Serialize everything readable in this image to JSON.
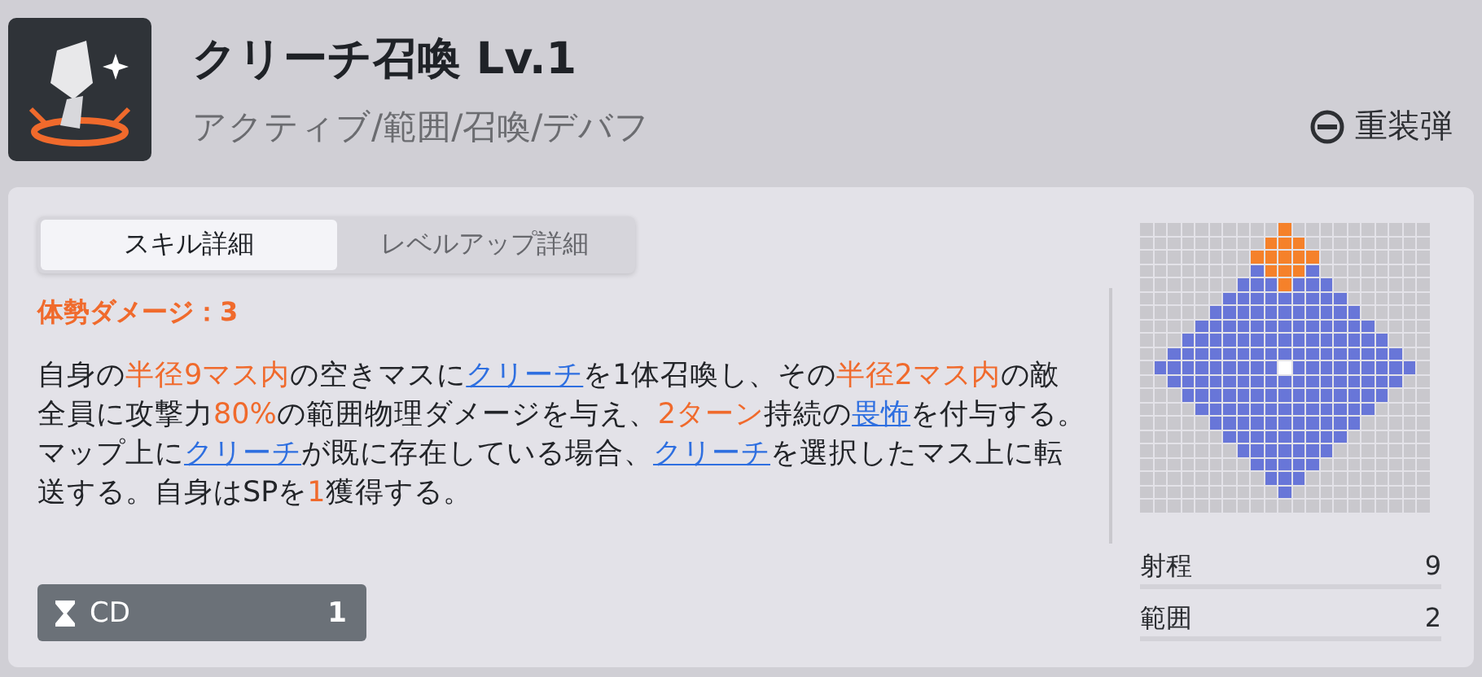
{
  "header": {
    "title": "クリーチ召喚 Lv.1",
    "tags": "アクティブ/範囲/召喚/デバフ",
    "ammo": "重装弾"
  },
  "tabs": [
    {
      "label": "スキル詳細",
      "selected": true
    },
    {
      "label": "レベルアップ詳細",
      "selected": false
    }
  ],
  "posture_damage": "体勢ダメージ：3",
  "description": [
    {
      "kind": "plain",
      "text": "自身の"
    },
    {
      "kind": "highlight",
      "text": "半径9マス内"
    },
    {
      "kind": "plain",
      "text": "の空きマスに"
    },
    {
      "kind": "link",
      "text": "クリーチ"
    },
    {
      "kind": "plain",
      "text": "を1体召喚し、その"
    },
    {
      "kind": "highlight",
      "text": "半径2マス内"
    },
    {
      "kind": "plain",
      "text": "の敵全員に攻撃力"
    },
    {
      "kind": "highlight",
      "text": "80%"
    },
    {
      "kind": "plain",
      "text": "の範囲物理ダメージを与え、"
    },
    {
      "kind": "highlight",
      "text": "2ターン"
    },
    {
      "kind": "plain",
      "text": "持続の"
    },
    {
      "kind": "link",
      "text": "畏怖"
    },
    {
      "kind": "plain",
      "text": "を付与する。マップ上に"
    },
    {
      "kind": "link",
      "text": "クリーチ"
    },
    {
      "kind": "plain",
      "text": "が既に存在している場合、"
    },
    {
      "kind": "link",
      "text": "クリーチ"
    },
    {
      "kind": "plain",
      "text": "を選択したマス上に転送する。自身はSPを"
    },
    {
      "kind": "highlight",
      "text": "1"
    },
    {
      "kind": "plain",
      "text": "獲得する。"
    }
  ],
  "cooldown": {
    "label": "CD",
    "value": "1"
  },
  "stats": [
    {
      "label": "射程",
      "value": "9"
    },
    {
      "label": "範囲",
      "value": "2"
    }
  ]
}
